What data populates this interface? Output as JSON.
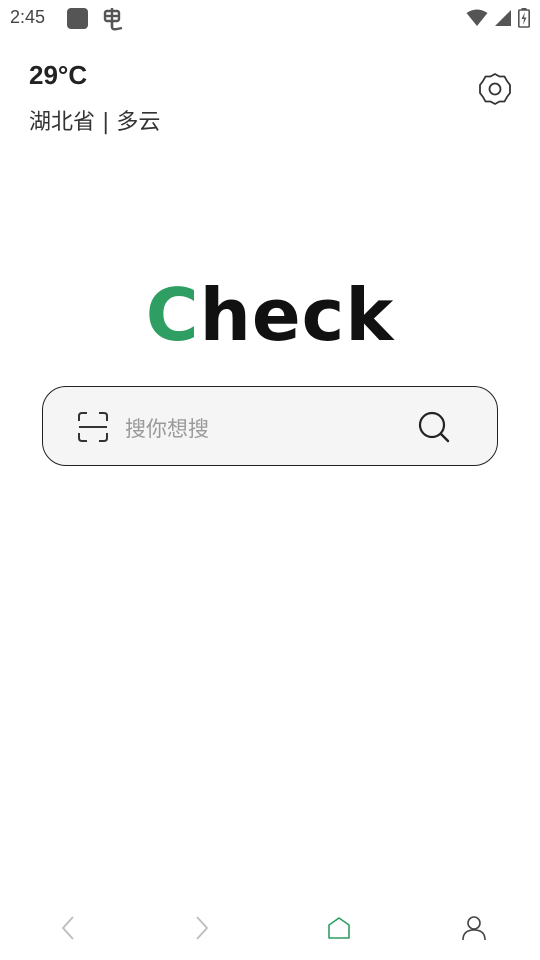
{
  "status_bar": {
    "time": "2:45",
    "icons": [
      "notification-square-icon",
      "bug-icon",
      "wifi-icon",
      "signal-icon",
      "battery-icon"
    ]
  },
  "weather": {
    "temperature": "29°C",
    "location": "湖北省 | 多云"
  },
  "logo": {
    "first_letter": "C",
    "rest": "heck",
    "accent_color": "#2e9e62"
  },
  "search": {
    "placeholder": "搜你想搜",
    "scan_icon": "scan-icon",
    "search_icon": "search-icon"
  },
  "bottom_nav": {
    "items": [
      "back-icon",
      "forward-icon",
      "home-icon",
      "profile-icon"
    ],
    "active": "home-icon",
    "active_color": "#2e9e62"
  }
}
